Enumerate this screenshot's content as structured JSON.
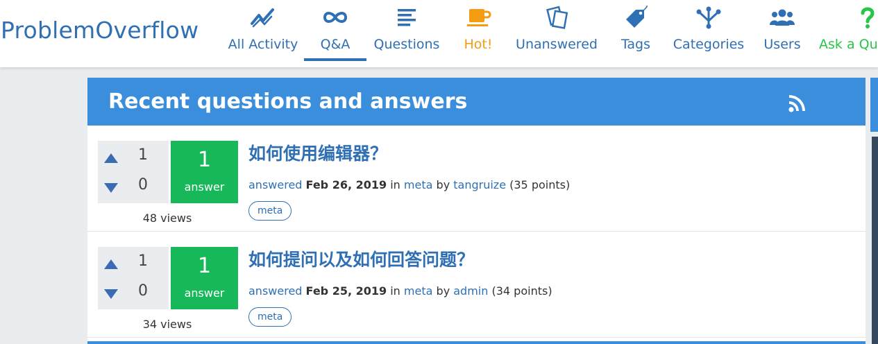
{
  "site": {
    "logo": "ProblemOverflow"
  },
  "nav": [
    {
      "label": "All Activity",
      "icon": "activity-icon"
    },
    {
      "label": "Q&A",
      "icon": "infinity-icon",
      "active": true
    },
    {
      "label": "Questions",
      "icon": "lines-icon"
    },
    {
      "label": "Hot!",
      "icon": "coffee-cup-icon"
    },
    {
      "label": "Unanswered",
      "icon": "cards-icon"
    },
    {
      "label": "Tags",
      "icon": "tag-icon"
    },
    {
      "label": "Categories",
      "icon": "tree-icon"
    },
    {
      "label": "Users",
      "icon": "users-icon"
    },
    {
      "label": "Ask a Qu",
      "icon": "question-mark-icon"
    }
  ],
  "panel": {
    "title": "Recent questions and answers",
    "rss_icon": "rss-icon"
  },
  "questions": [
    {
      "votes_up": "1",
      "votes_down": "0",
      "answers": "1",
      "answers_label": "answer",
      "views": "48 views",
      "title": "如何使用编辑器？",
      "action": "answered",
      "date": "Feb 26, 2019",
      "in_word": "in",
      "category": "meta",
      "by_word": "by",
      "user": "tangruize",
      "points": "(35 points)",
      "tag": "meta"
    },
    {
      "votes_up": "1",
      "votes_down": "0",
      "answers": "1",
      "answers_label": "answer",
      "views": "34 views",
      "title": "如何提问以及如何回答问题？",
      "action": "answered",
      "date": "Feb 25, 2019",
      "in_word": "in",
      "category": "meta",
      "by_word": "by",
      "user": "admin",
      "points": "(34 points)",
      "tag": "meta"
    }
  ],
  "colors": {
    "brand_blue": "#2f6fb3",
    "panel_blue": "#3a8edc",
    "answer_green": "#16b85a",
    "hot_orange": "#f39c12",
    "ask_green": "#27c548"
  }
}
